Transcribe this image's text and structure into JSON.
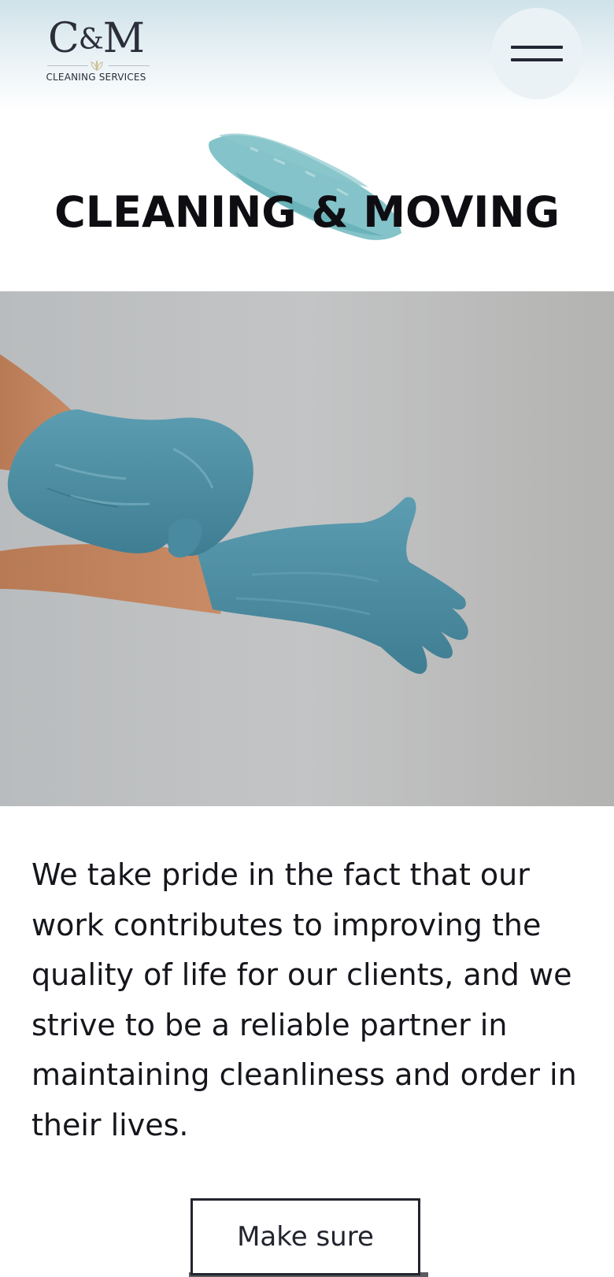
{
  "header": {
    "logo": {
      "mark_left": "C",
      "mark_amp": "&",
      "mark_right": "M",
      "subtitle": "CLEANING SERVICES"
    },
    "menu_icon": "hamburger-menu-icon"
  },
  "hero_section": {
    "title": "CLEANING & MOVING",
    "brush_color": "#6fb8bf",
    "image": "hands-in-blue-gloves"
  },
  "content": {
    "paragraph": "We take pride in the fact that our work contributes to improving the quality of life for our clients, and we strive to be a reliable partner in maintaining cleanliness and order in their lives.",
    "cta_label": "Make sure"
  },
  "colors": {
    "glove": "#4f8fa4",
    "text": "#15161c",
    "header_bg": "#cfe2e9"
  }
}
